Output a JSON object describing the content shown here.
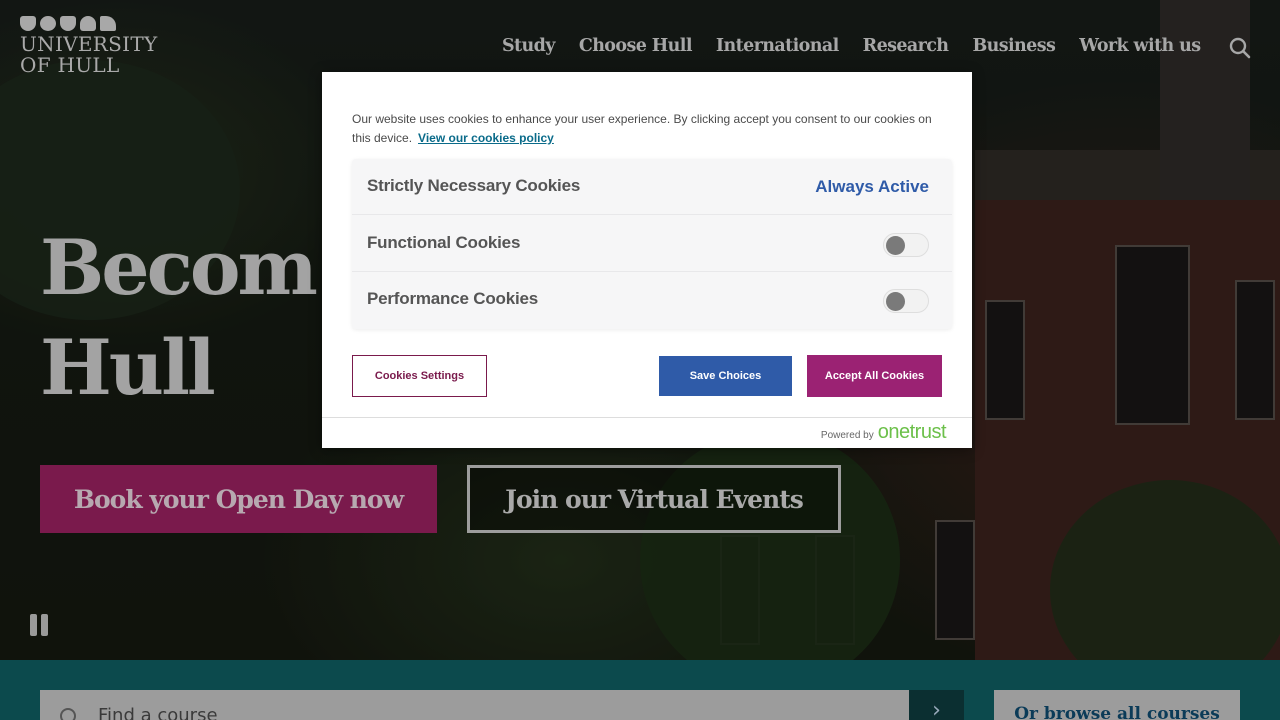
{
  "header": {
    "logo_line1": "UNIVERSITY",
    "logo_line2": "OF HULL",
    "nav": [
      "Study",
      "Choose Hull",
      "International",
      "Research",
      "Business",
      "Work with us"
    ]
  },
  "hero": {
    "title_line1": "Becom",
    "title_line2": "Hull",
    "cta_primary": "Book your Open Day now",
    "cta_secondary": "Join our Virtual Events"
  },
  "course_search": {
    "placeholder": "Find a course",
    "browse_label": "Or browse all courses"
  },
  "cookie_banner": {
    "message": "Our website uses cookies to enhance your user experience. By clicking accept you consent to our cookies on this device.",
    "policy_link": "View our cookies policy",
    "categories": [
      {
        "label": "Strictly Necessary Cookies",
        "status": "Always Active"
      },
      {
        "label": "Functional Cookies",
        "enabled": false
      },
      {
        "label": "Performance Cookies",
        "enabled": false
      }
    ],
    "settings_button": "Cookies Settings",
    "save_button": "Save Choices",
    "accept_button": "Accept All Cookies",
    "powered_by": "Powered by",
    "brand": "onetrust"
  },
  "colors": {
    "brand_magenta": "#9b2273",
    "save_blue": "#2f5ba8",
    "strip_teal": "#0c4a4d",
    "onetrust_green": "#6cc04a"
  }
}
